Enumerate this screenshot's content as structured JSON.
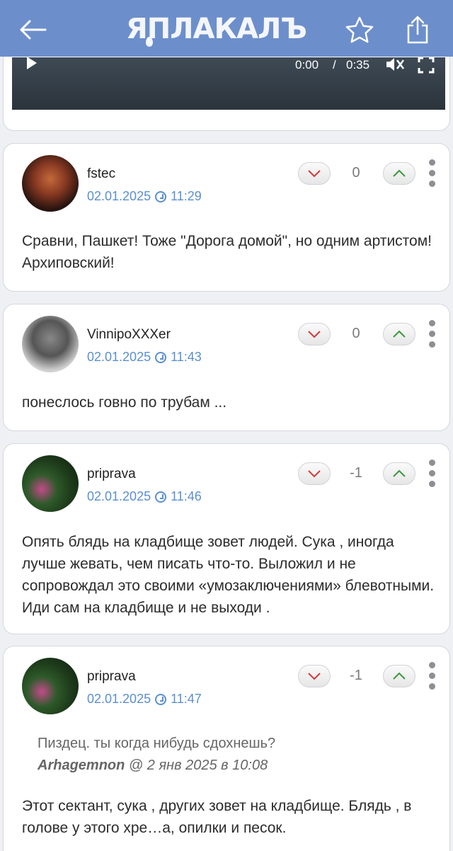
{
  "header": {
    "logo_text": "ЯПЛАКАЛЪ",
    "back_icon": "arrow-left-icon",
    "star_icon": "star-icon",
    "share_icon": "share-icon"
  },
  "video": {
    "current_time": "0:00",
    "separator": "/",
    "duration": "0:35"
  },
  "comments": [
    {
      "user": "fstec",
      "date": "02.01.2025",
      "time": "11:29",
      "score": "0",
      "text": "Сравни, Пашкет! Тоже \"Дорога домой\", но одним артистом! Архиповский!"
    },
    {
      "user": "VinnipoXXXer",
      "date": "02.01.2025",
      "time": "11:43",
      "score": "0",
      "text": "понеслось говно по трубам ..."
    },
    {
      "user": "priprava",
      "date": "02.01.2025",
      "time": "11:46",
      "score": "-1",
      "text": "Опять блядь на кладбище зовет людей. Сука , иногда лучше жевать, чем писать что-то. Выложил и не сопровождал это своими «умозаключениями» блевотными. Иди сам на кладбище и не выходи ."
    },
    {
      "user": "priprava",
      "date": "02.01.2025",
      "time": "11:47",
      "score": "-1",
      "quote_text": "Пиздец. ты когда нибудь сдохнешь?",
      "quote_author": "Arhagemnon",
      "quote_date": "@ 2 янв 2025 в 10:08",
      "text": "Этот сектант, сука , других зовет на кладбище. Блядь , в голове у этого хре…а, опилки и песок."
    }
  ]
}
